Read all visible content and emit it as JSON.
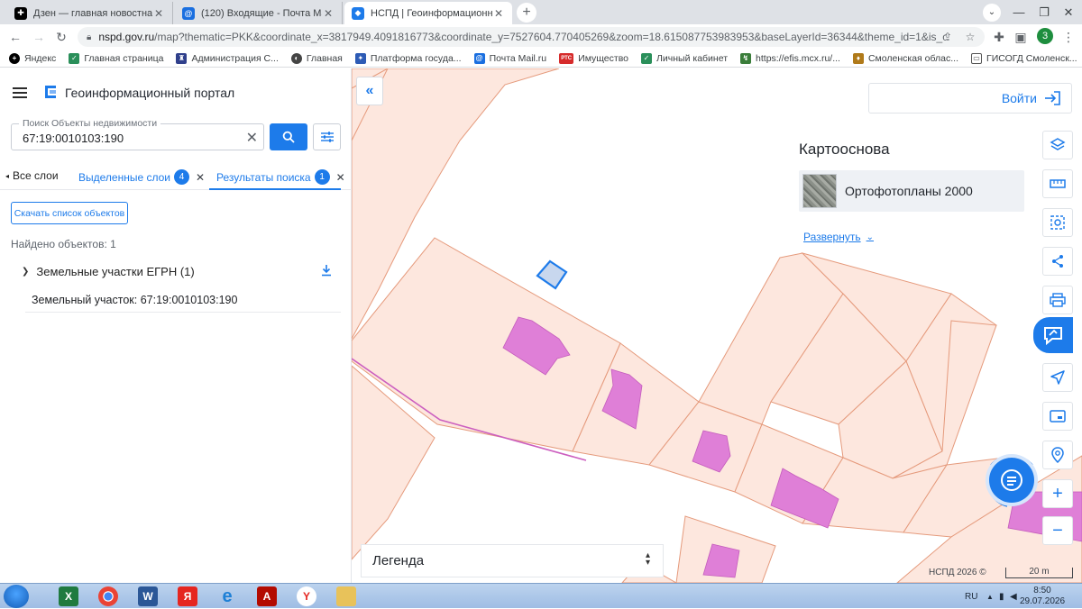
{
  "browser": {
    "tabs": [
      {
        "title": "Дзен — главная новостная инф",
        "active": false
      },
      {
        "title": "(120) Входящие - Почта Mail",
        "active": false
      },
      {
        "title": "НСПД | Геоинформационный п",
        "active": true
      }
    ],
    "url_domain": "nspd.gov.ru",
    "url_rest": "/map?thematic=PKK&coordinate_x=3817949.4091816773&coordinate_y=7527604.770405269&zoom=18.615087753983953&baseLayerId=36344&theme_id=1&is_copy_url=true...",
    "profile_initial": "3",
    "bookmarks": [
      "Яндекс",
      "Главная страница",
      "Администрация С...",
      "Главная",
      "Платформа госуда...",
      "Почта Mail.ru",
      "Имущество",
      "Личный кабинет",
      "https://efis.mcx.ru/...",
      "Смоленская облас...",
      "ГИСОГД Смоленск..."
    ]
  },
  "portal": {
    "title": "Геоинформационный портал"
  },
  "search": {
    "label": "Поиск Объекты недвижимости",
    "value": "67:19:0010103:190"
  },
  "panel_tabs": {
    "all_layers": "Все слои",
    "selected_layers": "Выделенные слои",
    "selected_count": "4",
    "search_results": "Результаты поиска",
    "results_count": "1"
  },
  "results": {
    "download_button": "Скачать список объектов",
    "found_text": "Найдено объектов: 1",
    "group_label": "Земельные участки ЕГРН (1)",
    "item_label": "Земельный участок: 67:19:0010103:190"
  },
  "map": {
    "login_label": "Войти",
    "basemap_title": "Картооснова",
    "basemap_name": "Ортофотопланы 2000",
    "expand_label": "Развернуть",
    "legend_label": "Легенда",
    "copyright": "НСПД 2026 ©",
    "scale_label": "20 m",
    "colors": {
      "parcel_fill": "#fde7de",
      "parcel_stroke": "#e59a7c",
      "building_fill": "#df7fd7",
      "accent": "#1d7bea"
    }
  },
  "taskbar": {
    "lang": "RU",
    "time": "8:50",
    "date": "29.07.2026"
  }
}
